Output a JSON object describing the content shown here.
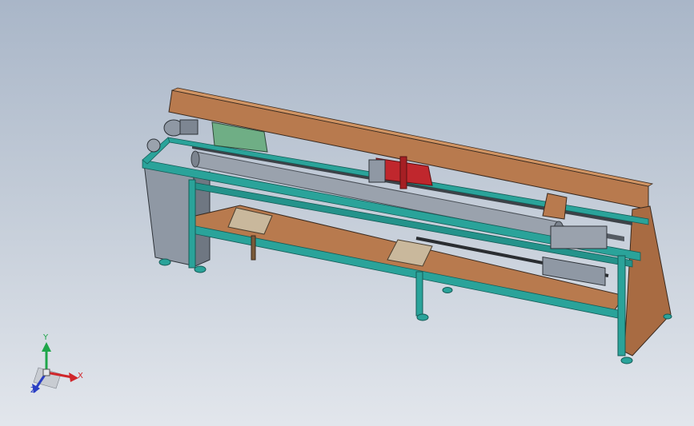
{
  "viewport": {
    "background_top": "#a9b6c8",
    "background_bottom": "#e2e6ec"
  },
  "model": {
    "colors": {
      "wood_panel": "#b87a4e",
      "wood_top": "#c98b5c",
      "frame_teal": "#2aa39a",
      "frame_dark": "#1f7f78",
      "cabinet_gray": "#8f98a4",
      "roller_gray": "#9aa2ad",
      "carriage_red": "#c0272d",
      "rail_dark": "#3d4248",
      "plate_beige": "#c9b89c"
    },
    "icons": {
      "motor": "motor-icon",
      "cutter_carriage": "carriage-icon"
    }
  },
  "triad": {
    "x_label": "X",
    "y_label": "Y",
    "z_label": "Z",
    "x_color": "#d0262b",
    "y_color": "#1fa64a",
    "z_color": "#2b3fc4"
  }
}
